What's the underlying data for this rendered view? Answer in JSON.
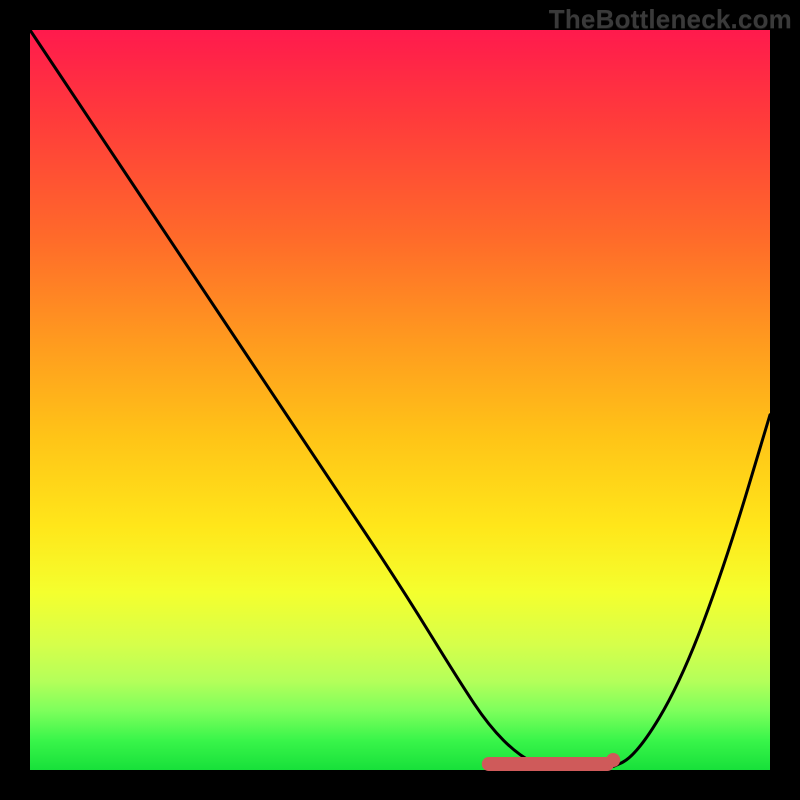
{
  "watermark": "TheBottleneck.com",
  "chart_data": {
    "type": "line",
    "title": "",
    "xlabel": "",
    "ylabel": "",
    "xlim": [
      0,
      100
    ],
    "ylim": [
      0,
      100
    ],
    "series": [
      {
        "name": "bottleneck-curve",
        "x": [
          0,
          10,
          20,
          30,
          40,
          50,
          58,
          62,
          66,
          70,
          74,
          78,
          82,
          88,
          94,
          100
        ],
        "values": [
          100,
          85,
          70,
          55,
          40,
          25,
          12,
          6,
          2,
          0,
          0,
          0,
          2,
          12,
          28,
          48
        ]
      }
    ],
    "annotations": [
      {
        "name": "optimal-zone",
        "kind": "marker-segment",
        "x_start": 62,
        "x_end": 78,
        "y": 0,
        "color": "#cf5a5a"
      }
    ],
    "background_gradient": {
      "top": "#ff1a4d",
      "mid": "#ffe61a",
      "bottom": "#17e03a"
    }
  },
  "colors": {
    "curve_stroke": "#000000",
    "marker_fill": "#cf5a5a",
    "frame": "#000000"
  }
}
